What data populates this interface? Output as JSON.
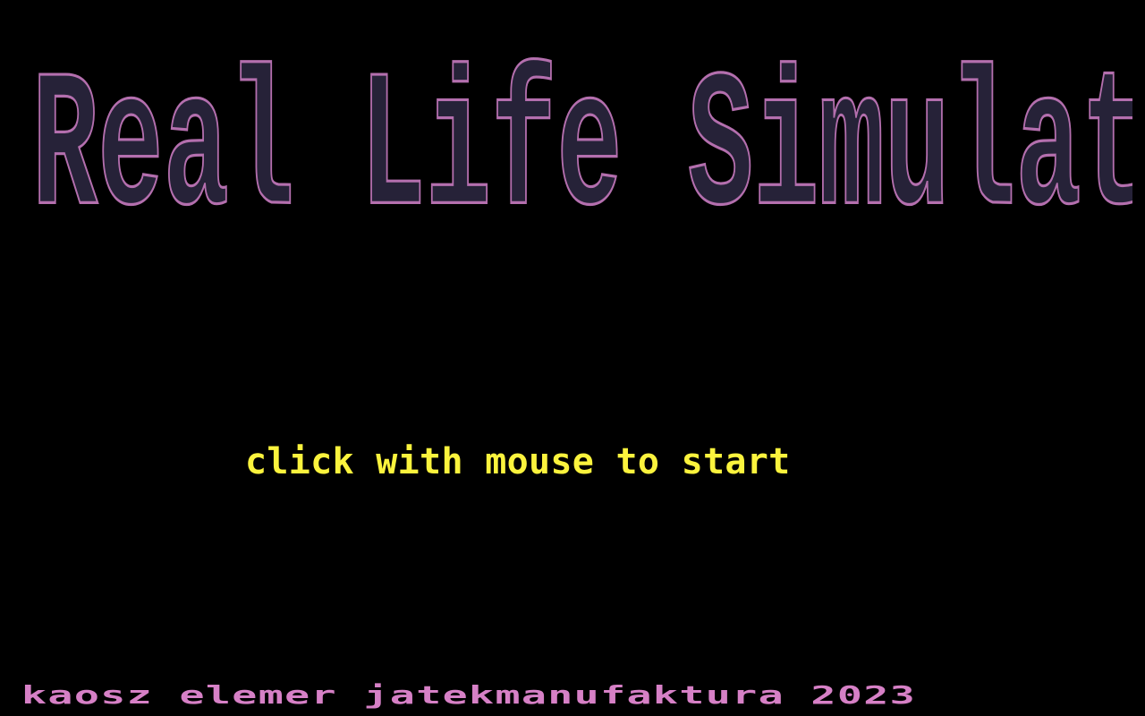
{
  "title": "Real Life Simulator",
  "start_prompt": "click with mouse to start",
  "credits": "kaosz elemer jatekmanufaktura 2023",
  "colors": {
    "background": "#000000",
    "title_fill": "#262238",
    "title_outline": "#b46fae",
    "prompt": "#fbf33d",
    "credits": "#d680c6"
  }
}
